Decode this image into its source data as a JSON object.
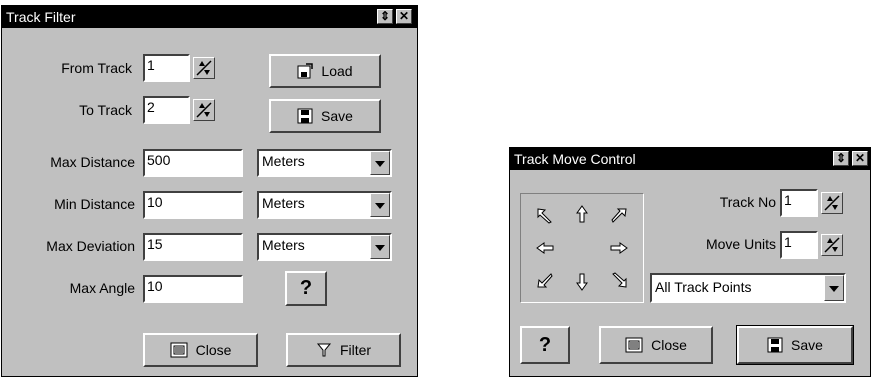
{
  "track_filter": {
    "title": "Track Filter",
    "from_track_label": "From Track",
    "from_track_value": "1",
    "to_track_label": "To Track",
    "to_track_value": "2",
    "load_label": "Load",
    "save_label": "Save",
    "max_distance_label": "Max Distance",
    "max_distance_value": "500",
    "max_distance_unit": "Meters",
    "min_distance_label": "Min Distance",
    "min_distance_value": "10",
    "min_distance_unit": "Meters",
    "max_deviation_label": "Max Deviation",
    "max_deviation_value": "15",
    "max_deviation_unit": "Meters",
    "max_angle_label": "Max Angle",
    "max_angle_value": "10",
    "help_label": "?",
    "close_label": "Close",
    "filter_label": "Filter"
  },
  "track_move_control": {
    "title": "Track Move Control",
    "track_no_label": "Track No",
    "track_no_value": "1",
    "move_units_label": "Move Units",
    "move_units_value": "1",
    "points_select": "All Track Points",
    "help_label": "?",
    "close_label": "Close",
    "save_label": "Save"
  },
  "icons": [
    "window-menu-icon",
    "close-icon",
    "spin-icon",
    "load-icon",
    "save-icon",
    "dropdown-arrow-icon",
    "close-doc-icon",
    "filter-icon",
    "arrow-icon"
  ]
}
